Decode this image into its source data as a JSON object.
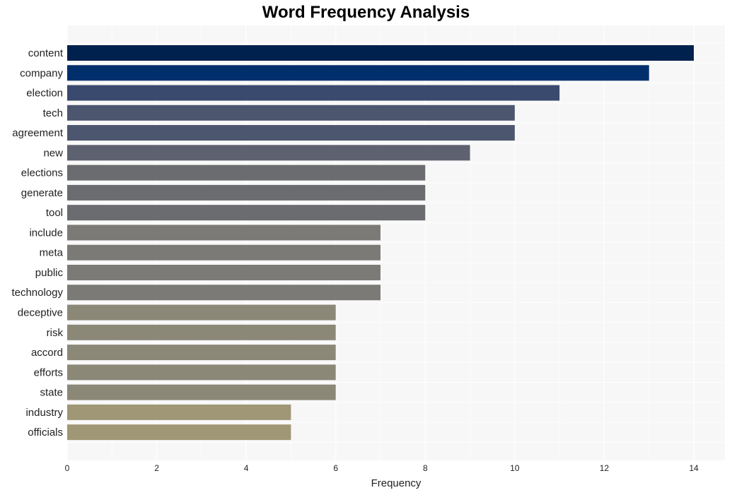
{
  "chart_data": {
    "type": "bar",
    "orientation": "horizontal",
    "title": "Word Frequency Analysis",
    "xlabel": "Frequency",
    "ylabel": "",
    "xlim": [
      0,
      14.7
    ],
    "xticks": [
      0,
      2,
      4,
      6,
      8,
      10,
      12,
      14
    ],
    "grid": true,
    "legend": "none",
    "categories": [
      "content",
      "company",
      "election",
      "tech",
      "agreement",
      "new",
      "elections",
      "generate",
      "tool",
      "include",
      "meta",
      "public",
      "technology",
      "deceptive",
      "risk",
      "accord",
      "efforts",
      "state",
      "industry",
      "officials"
    ],
    "values": [
      14,
      13,
      11,
      10,
      10,
      9,
      8,
      8,
      8,
      7,
      7,
      7,
      7,
      6,
      6,
      6,
      6,
      6,
      5,
      5
    ],
    "colors": [
      "#00204e",
      "#002f6c",
      "#3a4a6e",
      "#4d566f",
      "#4d566f",
      "#5e6170",
      "#6b6c70",
      "#6b6c70",
      "#6b6c70",
      "#7c7a77",
      "#7c7a77",
      "#7c7a77",
      "#7c7a77",
      "#8c8878",
      "#8c8878",
      "#8c8878",
      "#8c8878",
      "#8c8878",
      "#a09776",
      "#a09776"
    ],
    "background": "#f7f7f7"
  }
}
